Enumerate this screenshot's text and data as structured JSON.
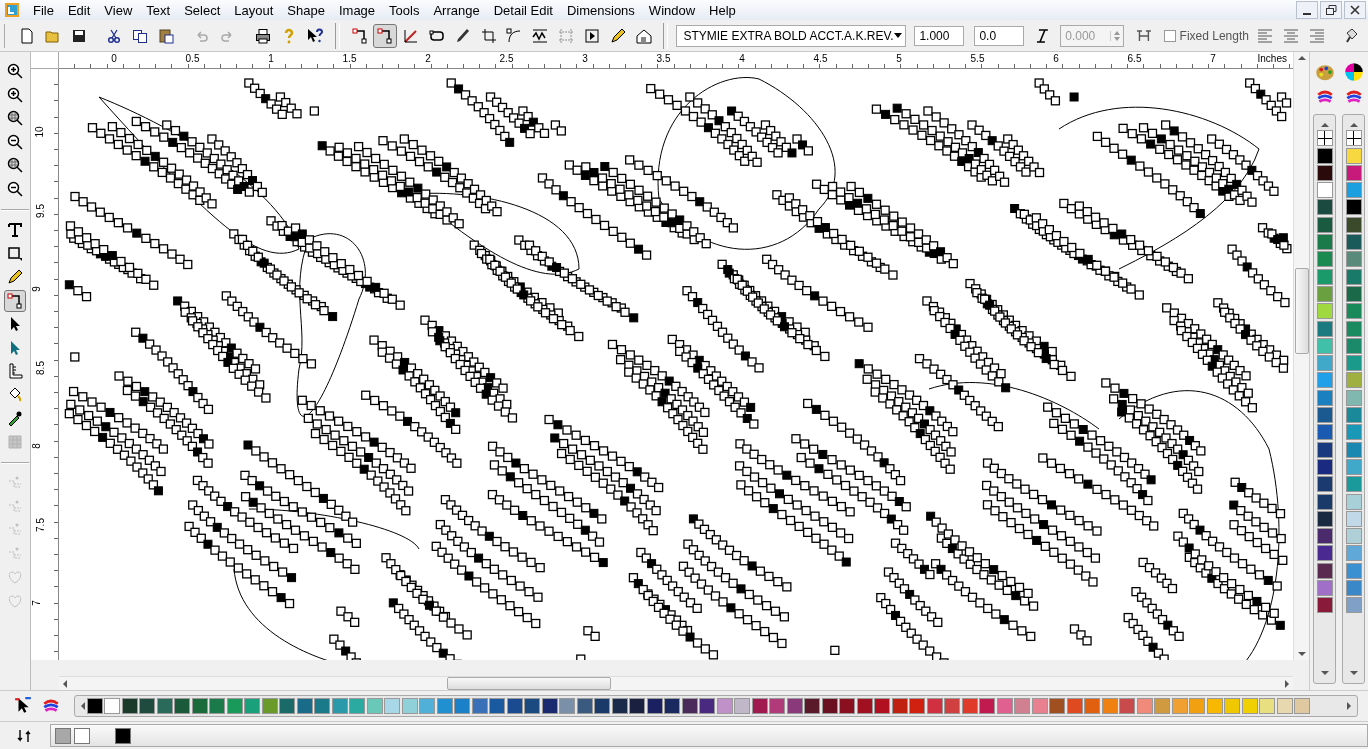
{
  "menu_bar": {
    "items": [
      "File",
      "Edit",
      "View",
      "Text",
      "Select",
      "Layout",
      "Shape",
      "Image",
      "Tools",
      "Arrange",
      "Detail Edit",
      "Dimensions",
      "Window",
      "Help"
    ]
  },
  "toolbar": {
    "history": [
      {
        "disabled": true
      },
      {
        "disabled": true
      }
    ],
    "edit_tools": [
      {
        "selected": false,
        "disabled": false
      },
      {
        "selected": true,
        "disabled": false
      },
      {
        "selected": false,
        "disabled": false
      },
      {
        "selected": false,
        "disabled": false
      },
      {
        "selected": false,
        "disabled": false
      },
      {
        "selected": false,
        "disabled": false
      },
      {
        "selected": false,
        "disabled": false
      },
      {
        "selected": false,
        "disabled": false
      },
      {
        "selected": false,
        "disabled": true
      },
      {
        "selected": false,
        "disabled": false
      },
      {
        "selected": false,
        "disabled": false
      },
      {
        "selected": false,
        "disabled": false
      }
    ],
    "font": "STYMIE EXTRA BOLD ACCT.A.K.REV.",
    "size": "1.000",
    "slant": "0.0",
    "spacing": {
      "value": "0.000",
      "disabled": true
    },
    "fixed_length": {
      "label": "Fixed Length",
      "checked": false
    }
  },
  "left_toolbar": {
    "tools": [
      {
        "selected": false,
        "disabled": false
      },
      {
        "selected": false,
        "disabled": false
      },
      {
        "selected": false,
        "disabled": false
      },
      {
        "selected": true,
        "disabled": false
      },
      {
        "selected": false,
        "disabled": false
      },
      {
        "selected": false,
        "disabled": false
      },
      {
        "selected": false,
        "disabled": false
      },
      {
        "selected": false,
        "disabled": false
      },
      {
        "selected": false,
        "disabled": false
      },
      {
        "selected": false,
        "disabled": true
      }
    ],
    "node_tools": [
      {
        "disabled": true
      },
      {
        "disabled": true
      },
      {
        "disabled": true
      },
      {
        "disabled": true
      },
      {
        "disabled": true
      },
      {
        "disabled": true
      }
    ]
  },
  "horizontal_ruler": {
    "labels": [
      "0",
      "0.5",
      "1",
      "1.5",
      "2",
      "2.5",
      "3",
      "3.5",
      "4",
      "4.5",
      "5",
      "5.5",
      "6",
      "6.5",
      "7"
    ],
    "unit": "Inches"
  },
  "vertical_ruler": {
    "labels": [
      "10",
      "9.5",
      "9",
      "8.5",
      "8",
      "7.5",
      "7"
    ]
  },
  "right_palettes": [
    {
      "swatches": [
        {
          "color": "#000000"
        },
        {
          "color": "#2a0a0a"
        },
        {
          "color": "#ffffff"
        },
        {
          "color": "#1a4a40"
        },
        {
          "color": "#1a5a40"
        },
        {
          "color": "#1a7a4a"
        },
        {
          "color": "#1a8a50"
        },
        {
          "color": "#1a9a6a"
        },
        {
          "color": "#6aa040"
        },
        {
          "color": "#a0d840"
        },
        {
          "color": "#1a7a80"
        },
        {
          "color": "#40c0a8"
        },
        {
          "color": "#40a8c8"
        },
        {
          "color": "#20a0e8"
        },
        {
          "color": "#1a80c0"
        },
        {
          "color": "#1a5a90"
        },
        {
          "color": "#1a5ab0"
        },
        {
          "color": "#1a3a80"
        },
        {
          "color": "#1a2a80"
        },
        {
          "color": "#1a3a70"
        },
        {
          "color": "#1a3a6a"
        },
        {
          "color": "#1a2a40"
        },
        {
          "color": "#4a2a6a"
        },
        {
          "color": "#4a2a90"
        },
        {
          "color": "#5a2a50"
        },
        {
          "color": "#a070c8"
        },
        {
          "color": "#8a1a3a"
        }
      ]
    },
    {
      "swatches": [
        {
          "color": "#f8d840"
        },
        {
          "color": "#c81a7a"
        },
        {
          "color": "#1aa0e0"
        },
        {
          "color": "#000000"
        },
        {
          "color": "#3a4a2a"
        },
        {
          "color": "#1a5a5a"
        },
        {
          "color": "#5a8a7a"
        },
        {
          "color": "#1a7a6a"
        },
        {
          "color": "#1a6a4a"
        },
        {
          "color": "#1a8a5a"
        },
        {
          "color": "#1a8a60"
        },
        {
          "color": "#1a8a6a"
        },
        {
          "color": "#1a9a8a"
        },
        {
          "color": "#a0b040"
        },
        {
          "color": "#80b8b0"
        },
        {
          "color": "#1a8a9a"
        },
        {
          "color": "#1a98b8"
        },
        {
          "color": "#1a88b0"
        },
        {
          "color": "#40a8c8"
        },
        {
          "color": "#1a9a9a"
        },
        {
          "color": "#a8d0d8"
        },
        {
          "color": "#c0d8e8"
        },
        {
          "color": "#b0d0d8"
        },
        {
          "color": "#60a8d8"
        },
        {
          "color": "#3a90d0"
        },
        {
          "color": "#3a88c8"
        },
        {
          "color": "#80a0c8"
        }
      ]
    }
  ],
  "bottom_palette": {
    "swatches": [
      {
        "color": "#000000"
      },
      {
        "color": "#ffffff"
      },
      {
        "color": "#1a3a2a"
      },
      {
        "color": "#1f4a3e"
      },
      {
        "color": "#2a6a5a"
      },
      {
        "color": "#1a5a3a"
      },
      {
        "color": "#1a6a3a"
      },
      {
        "color": "#1a7a4a"
      },
      {
        "color": "#1a9a5a"
      },
      {
        "color": "#1aa07a"
      },
      {
        "color": "#6a9a2a"
      },
      {
        "color": "#1a6a6a"
      },
      {
        "color": "#1a6a8a"
      },
      {
        "color": "#1a7a8a"
      },
      {
        "color": "#2a9aaa"
      },
      {
        "color": "#2aaaa0"
      },
      {
        "color": "#6ac8b8"
      },
      {
        "color": "#a8d8e8"
      },
      {
        "color": "#90d0d8"
      },
      {
        "color": "#50b0d8"
      },
      {
        "color": "#2090d0"
      },
      {
        "color": "#1a80c8"
      },
      {
        "color": "#3a70b8"
      },
      {
        "color": "#1a5aa0"
      },
      {
        "color": "#1a4a90"
      },
      {
        "color": "#1a4a80"
      },
      {
        "color": "#1a2a70"
      },
      {
        "color": "#7a90a8"
      },
      {
        "color": "#3a5a80"
      },
      {
        "color": "#1a3a6a"
      },
      {
        "color": "#1a2a4a"
      },
      {
        "color": "#1a2040"
      },
      {
        "color": "#1a2060"
      },
      {
        "color": "#1a2a60"
      },
      {
        "color": "#4a2a5a"
      },
      {
        "color": "#4a2a80"
      },
      {
        "color": "#c090c8"
      },
      {
        "color": "#c0b8c8"
      },
      {
        "color": "#a01a50"
      },
      {
        "color": "#b03a7a"
      },
      {
        "color": "#8a3a7a"
      },
      {
        "color": "#5a1a2a"
      },
      {
        "color": "#6a1020"
      },
      {
        "color": "#8a1020"
      },
      {
        "color": "#a01020"
      },
      {
        "color": "#b01020"
      },
      {
        "color": "#c02010"
      },
      {
        "color": "#d02010"
      },
      {
        "color": "#d03040"
      },
      {
        "color": "#d04040"
      },
      {
        "color": "#e03a2a"
      },
      {
        "color": "#c01a50"
      },
      {
        "color": "#e06090"
      },
      {
        "color": "#d08090"
      },
      {
        "color": "#e88090"
      },
      {
        "color": "#a05020"
      },
      {
        "color": "#e04a20"
      },
      {
        "color": "#e06010"
      },
      {
        "color": "#f08010"
      },
      {
        "color": "#c84a4a"
      },
      {
        "color": "#f08a7a"
      },
      {
        "color": "#d09a40"
      },
      {
        "color": "#f0a030"
      },
      {
        "color": "#f0a010"
      },
      {
        "color": "#f8b800"
      },
      {
        "color": "#f0c800"
      },
      {
        "color": "#f0d000"
      },
      {
        "color": "#e8e080"
      },
      {
        "color": "#e8d8b0"
      },
      {
        "color": "#e0c8a0"
      }
    ]
  },
  "status_bar": {
    "current_colors": [
      {
        "color": "#a8a8a8"
      },
      {
        "color": "#ffffff"
      },
      {
        "color": "#000000"
      }
    ]
  }
}
